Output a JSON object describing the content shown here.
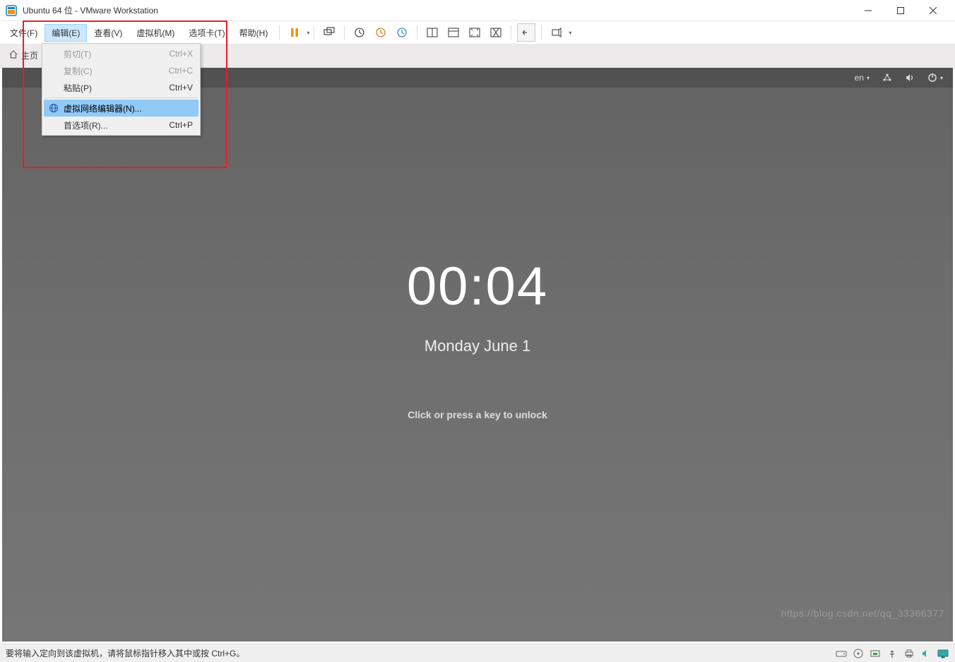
{
  "window": {
    "title": "Ubuntu 64 位 - VMware Workstation"
  },
  "menubar": {
    "file": "文件(F)",
    "edit": "编辑(E)",
    "view": "查看(V)",
    "vm": "虚拟机(M)",
    "tabs": "选项卡(T)",
    "help": "帮助(H)"
  },
  "edit_menu": {
    "cut": {
      "label": "剪切(T)",
      "shortcut": "Ctrl+X"
    },
    "copy": {
      "label": "复制(C)",
      "shortcut": "Ctrl+C"
    },
    "paste": {
      "label": "粘贴(P)",
      "shortcut": "Ctrl+V"
    },
    "vnet": {
      "label": "虚拟网络编辑器(N)..."
    },
    "prefs": {
      "label": "首选项(R)...",
      "shortcut": "Ctrl+P"
    }
  },
  "tabs_area": {
    "home": "主页"
  },
  "ubuntu": {
    "lang": "en",
    "time": "00:04",
    "date": "Monday June 1",
    "hint": "Click or press a key to unlock"
  },
  "statusbar": {
    "text": "要将输入定向到该虚拟机，请将鼠标指针移入其中或按 Ctrl+G。"
  },
  "watermark": "https://blog.csdn.net/qq_33366377"
}
